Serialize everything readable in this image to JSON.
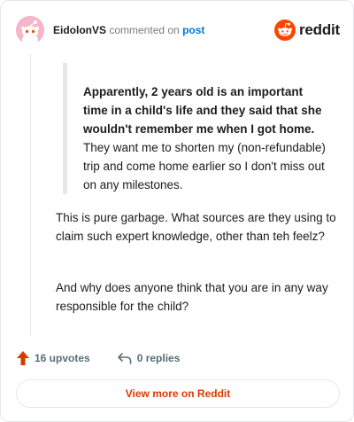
{
  "header": {
    "username": "EidolonVS",
    "action_text": "commented on",
    "post_link": "post",
    "brand_name": "reddit"
  },
  "comment": {
    "quote_bold": "Apparently, 2 years old is an important time in a child's life and they said that she wouldn't remember me when I got home.",
    "quote_rest": " They want me to shorten my (non-refundable) trip and come home earlier so I don't miss out on any milestones.",
    "paragraph_1": "This is pure garbage. What sources are they using to claim such expert knowledge, other than teh feelz?",
    "paragraph_2": "And why does anyone think that you are in any way responsible for the child?"
  },
  "footer": {
    "upvotes_label": "16 upvotes",
    "replies_label": "0 replies"
  },
  "cta": {
    "view_more_label": "View more on Reddit"
  },
  "colors": {
    "brand_orange": "#ff4500",
    "upvote_orange": "#d93a00",
    "link_blue": "#0079d3",
    "meta_gray": "#576f76",
    "avatar_pink": "#f4b6c8"
  },
  "icons": {
    "avatar": "snoo-avatar-icon",
    "brand": "reddit-logo-icon",
    "upvote": "upvote-arrow-icon",
    "reply": "reply-arrow-icon"
  }
}
